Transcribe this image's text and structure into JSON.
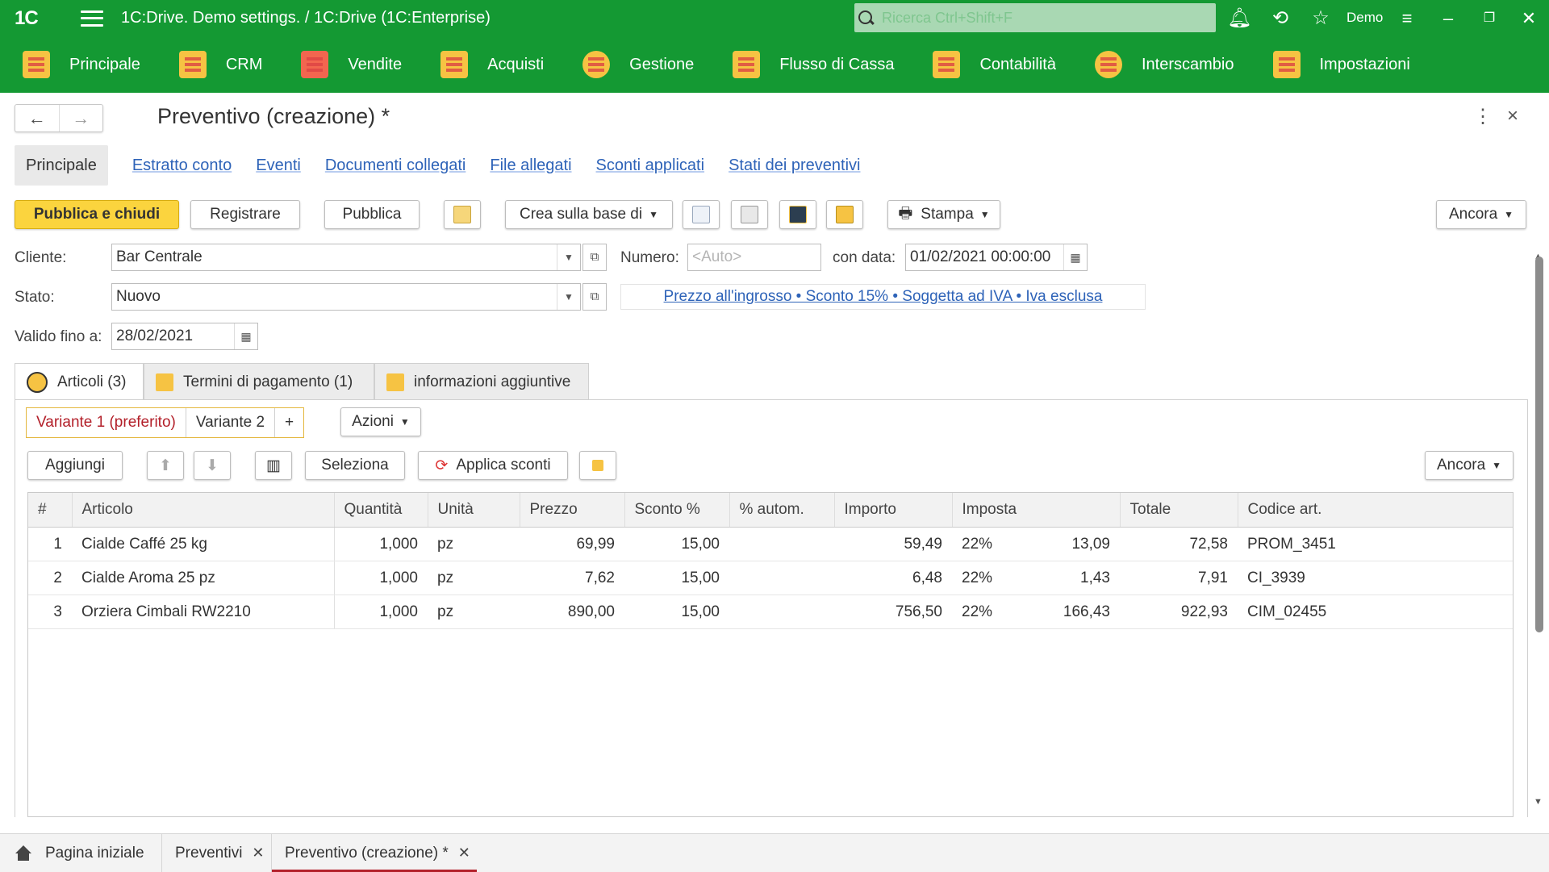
{
  "titlebar": {
    "logo": "1C",
    "app_title": "1C:Drive. Demo settings. / 1C:Drive  (1C:Enterprise)",
    "search_placeholder": "Ricerca Ctrl+Shift+F",
    "user": "Demo"
  },
  "sections": [
    {
      "label": "Principale",
      "color": "#f6c343"
    },
    {
      "label": "CRM",
      "color": "#f6c343"
    },
    {
      "label": "Vendite",
      "color": "#e24a4a"
    },
    {
      "label": "Acquisti",
      "color": "#f6c343"
    },
    {
      "label": "Gestione",
      "color": "#f6c343"
    },
    {
      "label": "Flusso di Cassa",
      "color": "#f6c343"
    },
    {
      "label": "Contabilità",
      "color": "#f6c343"
    },
    {
      "label": "Interscambio",
      "color": "#f6c343"
    },
    {
      "label": "Impostazioni",
      "color": "#f6c343"
    }
  ],
  "document": {
    "title": "Preventivo (creazione) *"
  },
  "nav_links": {
    "active": "Principale",
    "links": [
      "Estratto conto",
      "Eventi",
      "Documenti collegati",
      "File allegati",
      "Sconti applicati",
      "Stati dei preventivi"
    ]
  },
  "toolbar": {
    "publish_close": "Pubblica e chiudi",
    "register": "Registrare",
    "publish": "Pubblica",
    "create_based": "Crea sulla base di",
    "print": "Stampa",
    "more": "Ancora"
  },
  "form": {
    "client_label": "Cliente:",
    "client_value": "Bar Centrale",
    "number_label": "Numero:",
    "number_placeholder": "<Auto>",
    "date_label": "con data:",
    "date_value": "01/02/2021 00:00:00",
    "status_label": "Stato:",
    "status_value": "Nuovo",
    "price_info": "Prezzo all'ingrosso • Sconto 15% • Soggetta ad IVA • Iva esclusa",
    "valid_label": "Valido fino a:",
    "valid_value": "28/02/2021"
  },
  "tabs": [
    "Articoli (3)",
    "Termini di pagamento (1)",
    "informazioni aggiuntive"
  ],
  "variants": [
    "Variante 1 (preferito)",
    "Variante 2",
    "+"
  ],
  "actions_label": "Azioni",
  "table_toolbar": {
    "add": "Aggiungi",
    "select": "Seleziona",
    "apply_discounts": "Applica sconti",
    "more": "Ancora"
  },
  "table": {
    "columns": [
      "#",
      "Articolo",
      "Quantità",
      "Unità",
      "Prezzo",
      "Sconto %",
      "% autom.",
      "Importo",
      "Imposta",
      "Totale",
      "Codice art."
    ],
    "rows": [
      [
        "1",
        "Cialde Caffé 25 kg",
        "1,000",
        "pz",
        "69,99",
        "15,00",
        "",
        "59,49",
        "22%",
        "13,09",
        "72,58",
        "PROM_3451"
      ],
      [
        "2",
        "Cialde Aroma 25 pz",
        "1,000",
        "pz",
        "7,62",
        "15,00",
        "",
        "6,48",
        "22%",
        "1,43",
        "7,91",
        "CI_3939"
      ],
      [
        "3",
        "Orziera Cimbali RW2210",
        "1,000",
        "pz",
        "890,00",
        "15,00",
        "",
        "756,50",
        "22%",
        "166,43",
        "922,93",
        "CIM_02455"
      ]
    ]
  },
  "bottom_tabs": [
    "Pagina iniziale",
    "Preventivi",
    "Preventivo (creazione) *"
  ]
}
